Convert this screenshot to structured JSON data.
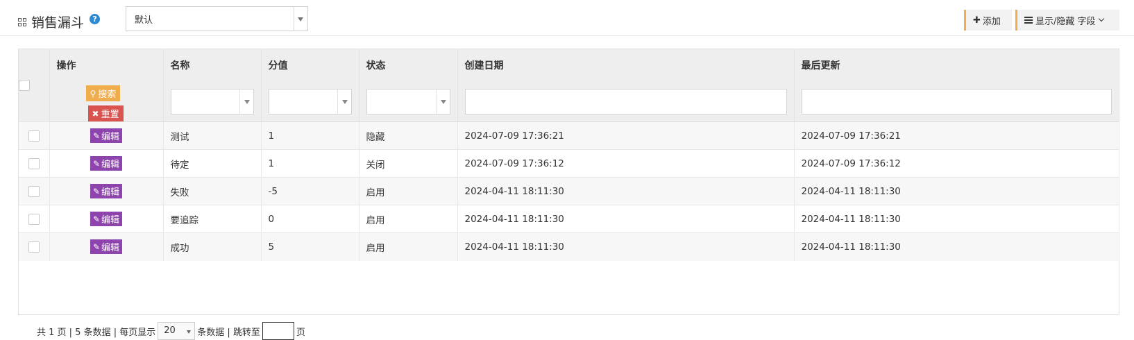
{
  "header": {
    "title": "销售漏斗",
    "help_icon": "help-circle-icon",
    "view_select_value": "默认",
    "add_label": "添加",
    "columns_label": "显示/隐藏 字段",
    "accent": "#f0ad4e"
  },
  "table": {
    "columns": [
      "操作",
      "名称",
      "分值",
      "状态",
      "创建日期",
      "最后更新"
    ],
    "search_label": "搜索",
    "reset_label": "重置",
    "edit_label": "编辑",
    "rows": [
      {
        "name": "测试",
        "score": "1",
        "status": "隐藏",
        "created": "2024-07-09 17:36:21",
        "updated": "2024-07-09 17:36:21"
      },
      {
        "name": "待定",
        "score": "1",
        "status": "关闭",
        "created": "2024-07-09 17:36:12",
        "updated": "2024-07-09 17:36:12"
      },
      {
        "name": "失败",
        "score": "-5",
        "status": "启用",
        "created": "2024-04-11 18:11:30",
        "updated": "2024-04-11 18:11:30"
      },
      {
        "name": "要追踪",
        "score": "0",
        "status": "启用",
        "created": "2024-04-11 18:11:30",
        "updated": "2024-04-11 18:11:30"
      },
      {
        "name": "成功",
        "score": "5",
        "status": "启用",
        "created": "2024-04-11 18:11:30",
        "updated": "2024-04-11 18:11:30"
      }
    ],
    "colors": {
      "search": "#f0ad4e",
      "reset": "#d9534f",
      "edit": "#8e44ad"
    }
  },
  "pager": {
    "summary": "共 1 页 | 5 条数据 | 每页显示",
    "page_size": "20",
    "after_size": "条数据 | 跳转至",
    "page_unit": "页"
  }
}
